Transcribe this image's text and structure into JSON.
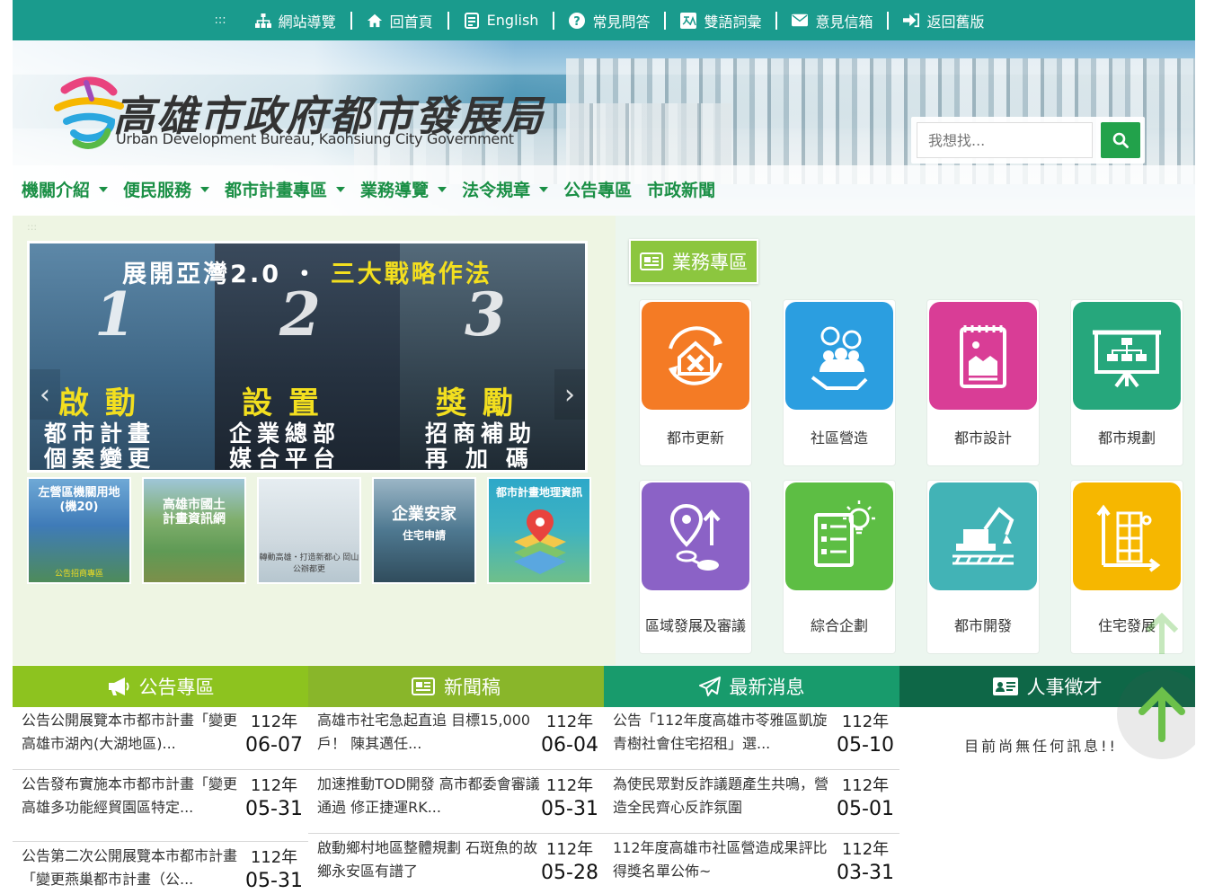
{
  "topbar": {
    "accesskey": ":::",
    "items": [
      {
        "label": "網站導覽",
        "icon": "sitemap-icon"
      },
      {
        "label": "回首頁",
        "icon": "home-icon"
      },
      {
        "label": "English",
        "icon": "english-icon"
      },
      {
        "label": "常見問答",
        "icon": "question-icon"
      },
      {
        "label": "雙語詞彙",
        "icon": "translate-icon"
      },
      {
        "label": "意見信箱",
        "icon": "mail-icon"
      },
      {
        "label": "返回舊版",
        "icon": "return-icon"
      }
    ]
  },
  "brand": {
    "name_zh": "高雄市政府都市發展局",
    "name_en": "Urban Development Bureau, Kaohsiung City Government"
  },
  "search": {
    "placeholder": "我想找..."
  },
  "nav": [
    {
      "label": "機關介紹",
      "dropdown": true
    },
    {
      "label": "便民服務",
      "dropdown": true
    },
    {
      "label": "都市計畫專區",
      "dropdown": true
    },
    {
      "label": "業務導覽",
      "dropdown": true
    },
    {
      "label": "法令規章",
      "dropdown": true
    },
    {
      "label": "公告專區",
      "dropdown": false
    },
    {
      "label": "市政新聞",
      "dropdown": false
    }
  ],
  "anchor": ":::",
  "carousel": {
    "title_white": "展開亞灣2.0 ・",
    "title_yellow": "三大戰略作法",
    "columns": [
      {
        "num": "1",
        "big": "啟動",
        "line1": "都市計畫",
        "line2": "個案變更"
      },
      {
        "num": "2",
        "big": "設置",
        "line1": "企業總部",
        "line2": "媒合平台"
      },
      {
        "num": "3",
        "big": "獎勵",
        "line1": "招商補助",
        "line2": "再加碼"
      }
    ]
  },
  "thumbs": [
    {
      "line1": "左營區機關用地",
      "line2": "(機20)",
      "caption": "公告招商專區",
      "color": "#3f7bb8"
    },
    {
      "line1": "高雄市國土",
      "line2": "計畫資訊網",
      "caption": "",
      "color": "#5f9a55"
    },
    {
      "line1": "",
      "line2": "",
      "caption": "轉動高雄・打造新都心 岡山公辦都更",
      "color": "#cfd9df"
    },
    {
      "line1": "企業安家",
      "line2": "住宅申請",
      "caption": "",
      "color": "#4e7890"
    },
    {
      "line1": "都市計畫地理資訊",
      "line2": "",
      "caption": "",
      "color": "#2da8c9"
    }
  ],
  "business": {
    "title": "業務專區",
    "tiles": [
      {
        "label": "都市更新",
        "color": "#f47b25",
        "icon": "urban-renewal-icon"
      },
      {
        "label": "社區營造",
        "color": "#2b9ee0",
        "icon": "community-icon"
      },
      {
        "label": "都市設計",
        "color": "#d93d96",
        "icon": "urban-design-icon"
      },
      {
        "label": "都市規劃",
        "color": "#26a77c",
        "icon": "urban-planning-icon"
      },
      {
        "label": "區域發展及審議",
        "color": "#8b62c6",
        "icon": "regional-development-icon"
      },
      {
        "label": "綜合企劃",
        "color": "#5dbe44",
        "icon": "planning-icon"
      },
      {
        "label": "都市開發",
        "color": "#42b3b6",
        "icon": "urban-development-icon"
      },
      {
        "label": "住宅發展",
        "color": "#f6b700",
        "icon": "housing-icon"
      }
    ]
  },
  "sections": [
    {
      "title": "公告專區",
      "color": "#8dc31f",
      "icon": "megaphone-icon"
    },
    {
      "title": "新聞稿",
      "color": "#89b62a",
      "icon": "newspaper-icon"
    },
    {
      "title": "最新消息",
      "color": "#189b6c",
      "icon": "paper-plane-icon"
    },
    {
      "title": "人事徵才",
      "color": "#0e6747",
      "icon": "id-card-icon"
    }
  ],
  "announcements": [
    {
      "text": "公告公開展覽本市都市計畫「變更高雄市湖內(大湖地區)...",
      "year": "112年",
      "date": "06-07"
    },
    {
      "text": "公告發布實施本市都市計畫「變更高雄多功能經貿園區特定...",
      "year": "112年",
      "date": "05-31"
    },
    {
      "text": "公告第二次公開展覽本市都市計畫「變更燕巢都市計畫（公...",
      "year": "112年",
      "date": "05-31"
    }
  ],
  "press": [
    {
      "text": "高雄市社宅急起直追 目標15,000戶！ 陳其邁任...",
      "year": "112年",
      "date": "06-04"
    },
    {
      "text": "加速推動TOD開發 高市都委會審議通過 修正捷運RK...",
      "year": "112年",
      "date": "05-31"
    },
    {
      "text": "啟動鄉村地區整體規劃 石斑魚的故鄉永安區有譜了",
      "year": "112年",
      "date": "05-28"
    }
  ],
  "latest": [
    {
      "text": "公告「112年度高雄市苓雅區凱旋青樹社會住宅招租」選...",
      "year": "112年",
      "date": "05-10"
    },
    {
      "text": "為使民眾對反詐議題產生共鳴，營造全民齊心反詐氛圍",
      "year": "112年",
      "date": "05-01"
    },
    {
      "text": "112年度高雄市社區營造成果評比 得獎名單公佈~",
      "year": "112年",
      "date": "03-31"
    }
  ],
  "recruit": {
    "empty": "目前尚無任何訊息!!"
  }
}
